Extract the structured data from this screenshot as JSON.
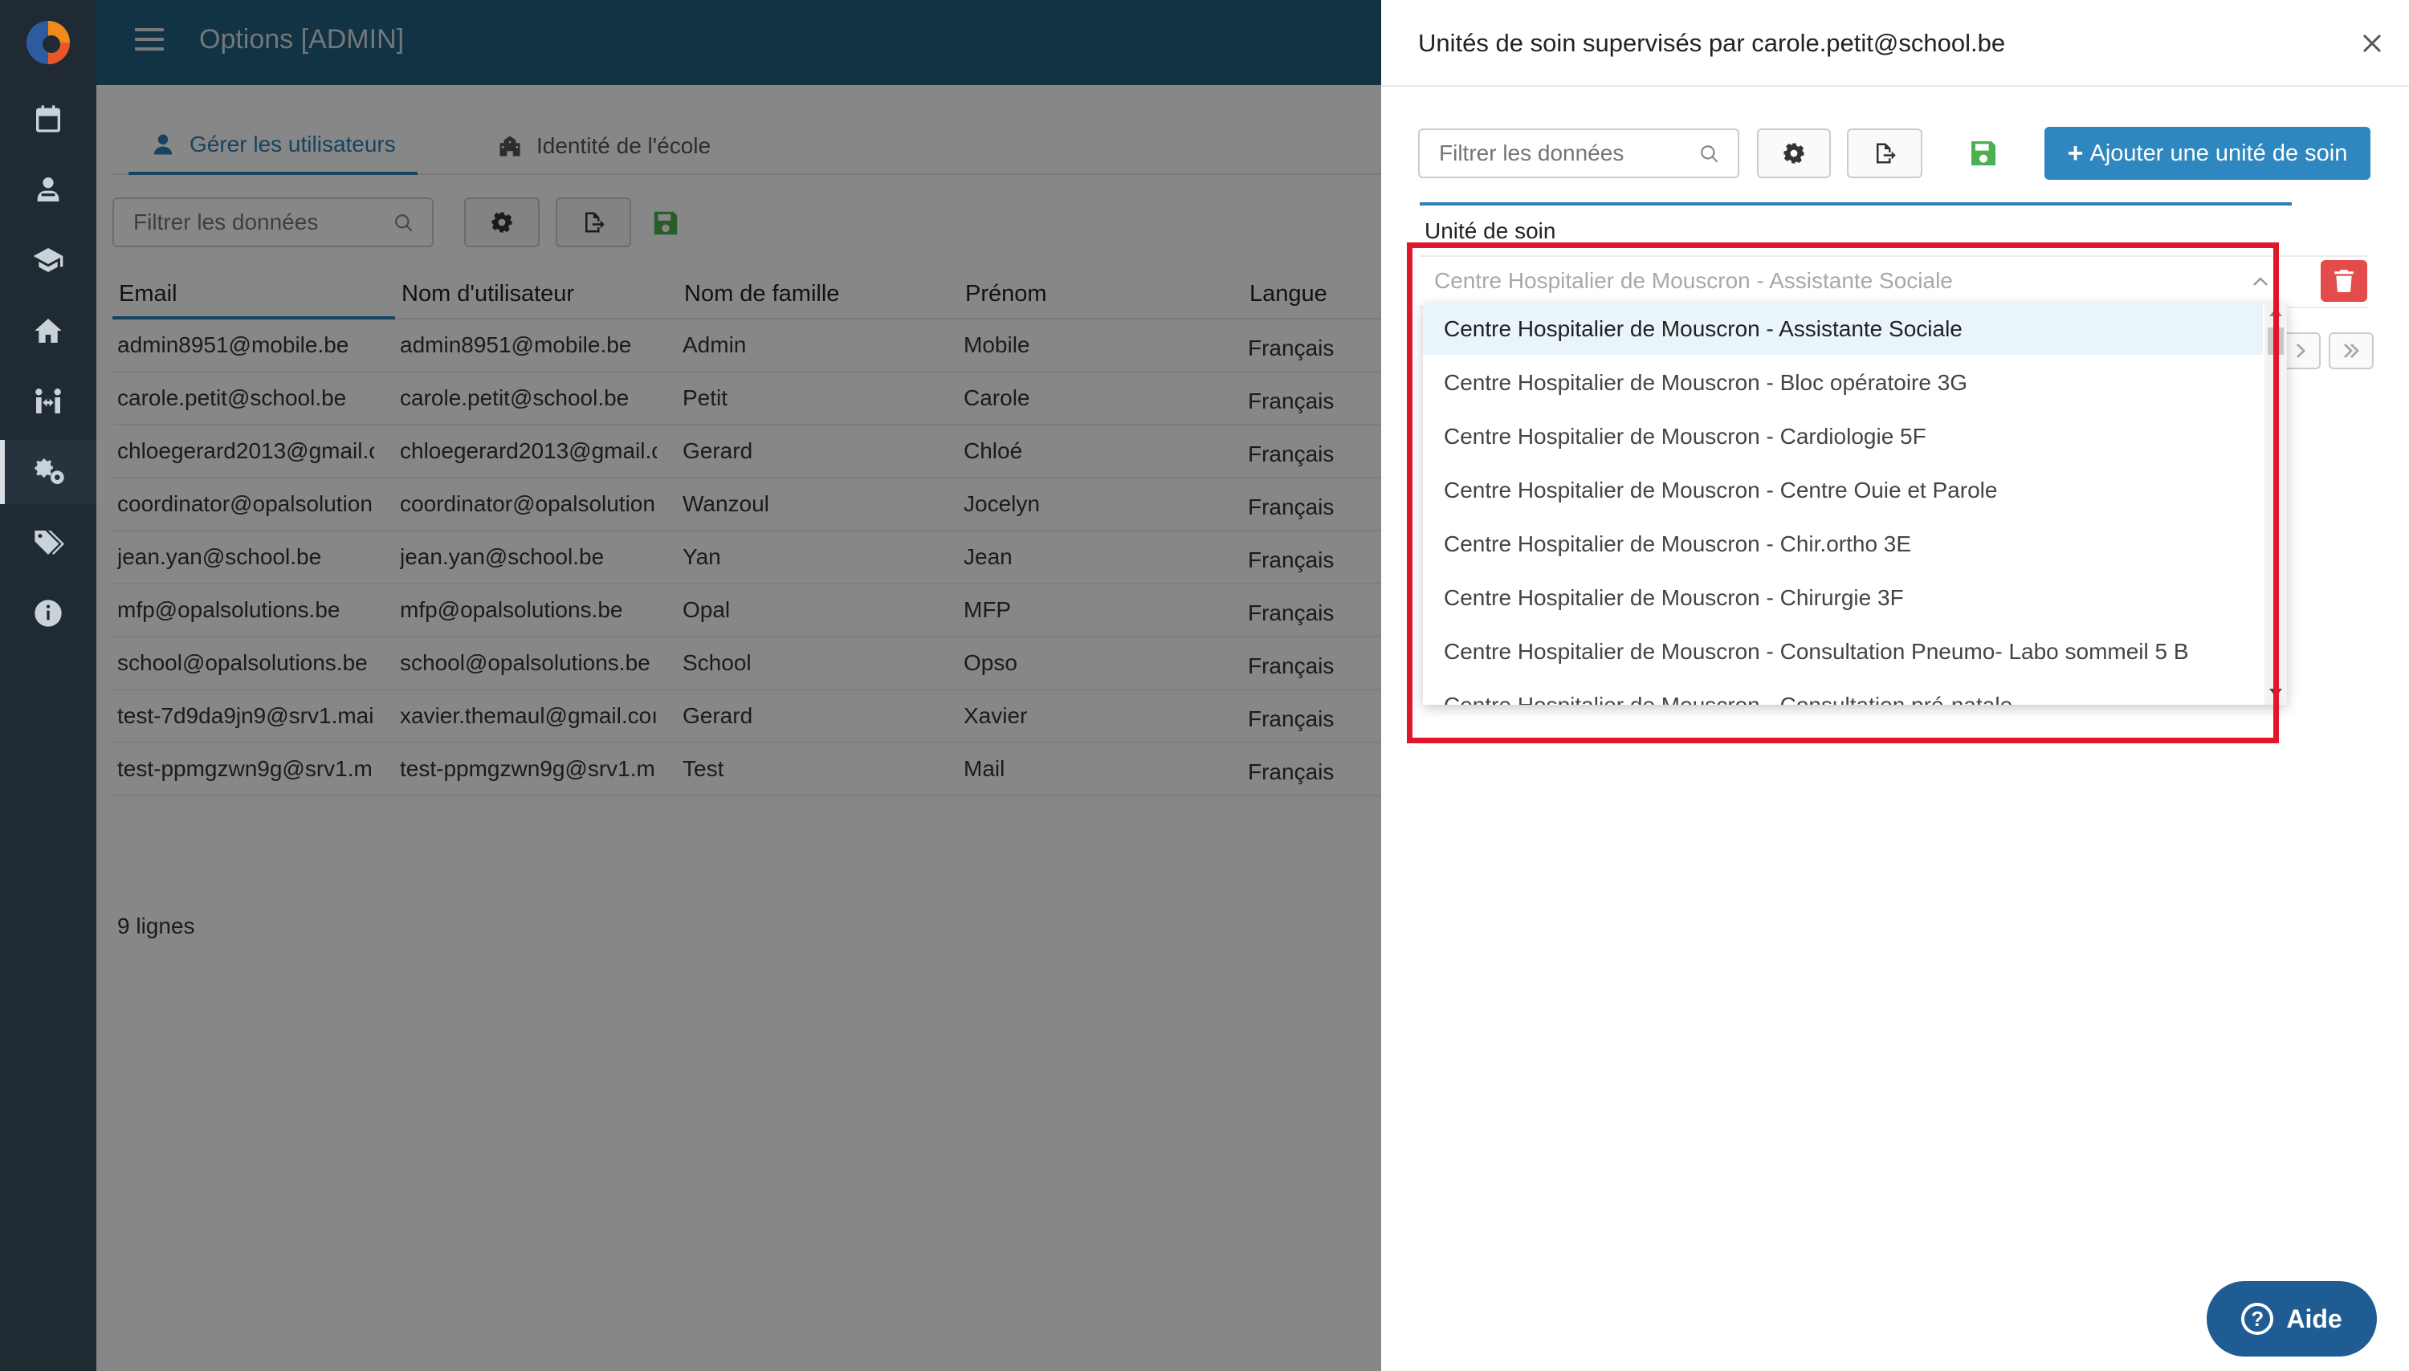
{
  "app": {
    "title": "Options [ADMIN]"
  },
  "sidebar": {
    "items": [
      {
        "icon": "calendar-icon"
      },
      {
        "icon": "teacher-icon"
      },
      {
        "icon": "graduation-cap-icon"
      },
      {
        "icon": "school-home-icon"
      },
      {
        "icon": "people-arrows-icon"
      },
      {
        "icon": "gears-icon"
      },
      {
        "icon": "tags-icon"
      },
      {
        "icon": "info-icon"
      }
    ],
    "active_index": 5
  },
  "tabs": [
    {
      "label": "Gérer les utilisateurs",
      "icon": "user-icon"
    },
    {
      "label": "Identité de l'école",
      "icon": "building-icon"
    }
  ],
  "main_toolbar": {
    "search_placeholder": "Filtrer les données"
  },
  "users_table": {
    "columns": [
      "Email",
      "Nom d'utilisateur",
      "Nom de famille",
      "Prénom",
      "Langue"
    ],
    "rows": [
      [
        "admin8951@mobile.be",
        "admin8951@mobile.be",
        "Admin",
        "Mobile",
        "Français"
      ],
      [
        "carole.petit@school.be",
        "carole.petit@school.be",
        "Petit",
        "Carole",
        "Français"
      ],
      [
        "chloegerard2013@gmail.c",
        "chloegerard2013@gmail.c",
        "Gerard",
        "Chloé",
        "Français"
      ],
      [
        "coordinator@opalsolution",
        "coordinator@opalsolution",
        "Wanzoul",
        "Jocelyn",
        "Français"
      ],
      [
        "jean.yan@school.be",
        "jean.yan@school.be",
        "Yan",
        "Jean",
        "Français"
      ],
      [
        "mfp@opalsolutions.be",
        "mfp@opalsolutions.be",
        "Opal",
        "MFP",
        "Français"
      ],
      [
        "school@opalsolutions.be",
        "school@opalsolutions.be",
        "School",
        "Opso",
        "Français"
      ],
      [
        "test-7d9da9jn9@srv1.mai",
        "xavier.themaul@gmail.coı",
        "Gerard",
        "Xavier",
        "Français"
      ],
      [
        "test-ppmgzwn9g@srv1.m",
        "test-ppmgzwn9g@srv1.m",
        "Test",
        "Mail",
        "Français"
      ]
    ],
    "row_count_label": "9 lignes"
  },
  "drawer": {
    "title": "Unités de soin supervisés par carole.petit@school.be",
    "search_placeholder": "Filtrer les données",
    "add_button_label": "Ajouter une unité de soin",
    "add_button_plus": "+",
    "column_header": "Unité de soin",
    "selected_value": "Centre Hospitalier de Mouscron - Assistante Sociale",
    "dropdown_options": [
      "Centre Hospitalier de Mouscron - Assistante Sociale",
      "Centre Hospitalier de Mouscron - Bloc opératoire 3G",
      "Centre Hospitalier de Mouscron - Cardiologie 5F",
      "Centre Hospitalier de Mouscron - Centre Ouie et Parole",
      "Centre Hospitalier de Mouscron - Chir.ortho 3E",
      "Centre Hospitalier de Mouscron - Chirurgie 3F",
      "Centre Hospitalier de Mouscron - Consultation Pneumo- Labo sommeil 5 B",
      "Centre Hospitalier de Mouscron - Consultation pré-natale"
    ]
  },
  "help": {
    "label": "Aide",
    "icon_glyph": "?"
  },
  "colors": {
    "sidebar_bg": "#1f2a33",
    "topbar_bg": "#23617f",
    "accent": "#2a7fb3",
    "primary_button": "#2f87bf",
    "save_green": "#4caf50",
    "delete_red": "#e44b4b",
    "highlight_red": "#e0162b",
    "help_bg": "#1f5c93"
  }
}
